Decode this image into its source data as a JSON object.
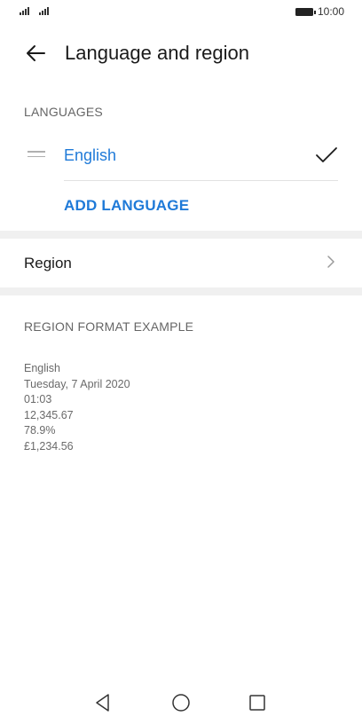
{
  "status_bar": {
    "time": "10:00",
    "icons": [
      "signal-icon",
      "signal-icon",
      "battery-icon"
    ]
  },
  "header": {
    "back_icon": "back-arrow-icon",
    "title": "Language and region"
  },
  "languages": {
    "section_label": "LANGUAGES",
    "items": [
      {
        "label": "English",
        "selected": true,
        "icon": "check-icon"
      }
    ],
    "add_label": "ADD LANGUAGE"
  },
  "region": {
    "label": "Region",
    "icon": "chevron-right-icon"
  },
  "region_format": {
    "section_label": "REGION FORMAT EXAMPLE",
    "lines": [
      "English",
      "Tuesday, 7 April 2020",
      "01:03",
      "12,345.67",
      "78.9%",
      "£1,234.56"
    ]
  },
  "nav_bar": {
    "icons": [
      "back-triangle-icon",
      "home-circle-icon",
      "recents-square-icon"
    ]
  },
  "colors": {
    "accent": "#1f7ad8",
    "section_band": "#f0f0f0",
    "divider": "#e2e2e2"
  }
}
